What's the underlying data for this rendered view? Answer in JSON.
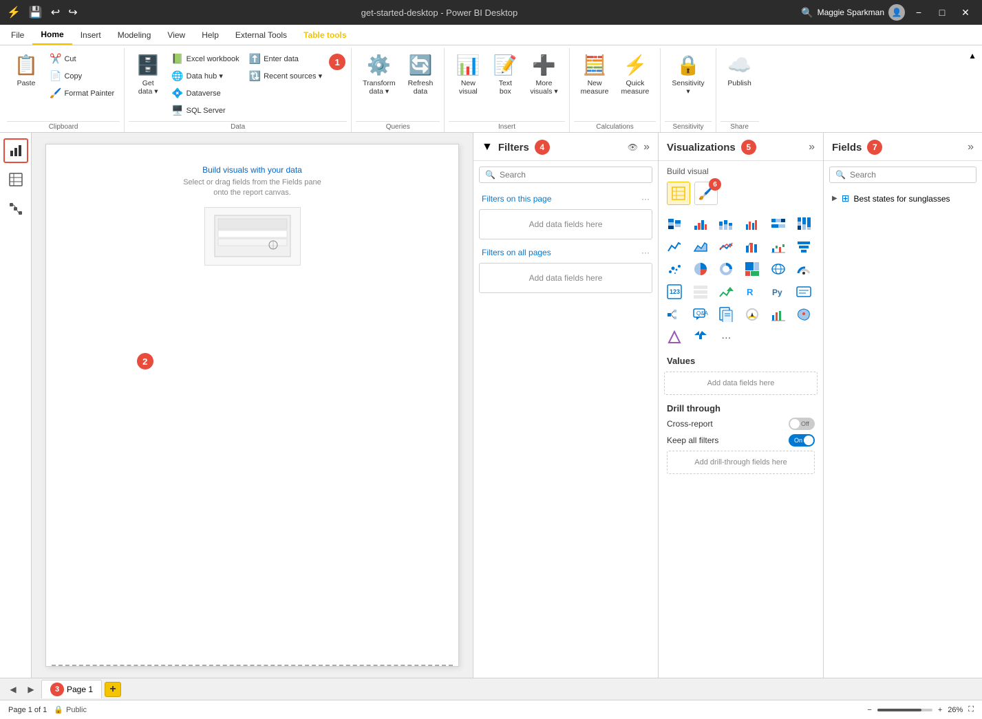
{
  "titleBar": {
    "title": "get-started-desktop - Power BI Desktop",
    "searchPlaceholder": "Search",
    "user": "Maggie Sparkman",
    "minimize": "−",
    "maximize": "□",
    "close": "✕",
    "saveIcon": "💾",
    "undoIcon": "↩",
    "redoIcon": "↪"
  },
  "menuBar": {
    "items": [
      {
        "label": "File",
        "active": false
      },
      {
        "label": "Home",
        "active": true
      },
      {
        "label": "Insert",
        "active": false
      },
      {
        "label": "Modeling",
        "active": false
      },
      {
        "label": "View",
        "active": false
      },
      {
        "label": "Help",
        "active": false
      },
      {
        "label": "External Tools",
        "active": false
      },
      {
        "label": "Table tools",
        "active": false,
        "highlighted": true
      }
    ]
  },
  "ribbon": {
    "groups": [
      {
        "label": "Clipboard",
        "items": [
          {
            "type": "large",
            "icon": "📋",
            "label": "Paste"
          },
          {
            "type": "small-col",
            "items": [
              {
                "icon": "✂️",
                "label": "Cut"
              },
              {
                "icon": "📄",
                "label": "Copy"
              },
              {
                "icon": "🖌️",
                "label": "Format Painter"
              }
            ]
          }
        ]
      },
      {
        "label": "Data",
        "items": [
          {
            "type": "large-split",
            "icon": "🗄️",
            "label": "Get\ndata",
            "hasDropdown": true
          },
          {
            "type": "small-col",
            "items": [
              {
                "icon": "📊",
                "label": "Excel workbook"
              },
              {
                "icon": "🌐",
                "label": "Data hub"
              },
              {
                "icon": "💠",
                "label": "Dataverse"
              },
              {
                "icon": "🖥️",
                "label": "SQL Server"
              }
            ]
          },
          {
            "type": "small-col",
            "items": [
              {
                "icon": "⬆️",
                "label": "Enter data"
              },
              {
                "icon": "🔃",
                "label": "Recent sources"
              }
            ]
          },
          {
            "type": "badge",
            "number": "1"
          }
        ]
      },
      {
        "label": "Queries",
        "items": [
          {
            "type": "large",
            "icon": "⚙️",
            "label": "Transform\ndata"
          },
          {
            "type": "large",
            "icon": "🔄",
            "label": "Refresh\ndata"
          }
        ]
      },
      {
        "label": "Insert",
        "items": [
          {
            "type": "large",
            "icon": "📊",
            "label": "New\nvisual"
          },
          {
            "type": "large",
            "icon": "📝",
            "label": "Text\nbox"
          },
          {
            "type": "large-split",
            "icon": "➕",
            "label": "More\nvisuals",
            "hasDropdown": true
          }
        ]
      },
      {
        "label": "Calculations",
        "items": [
          {
            "type": "large",
            "icon": "🧮",
            "label": "New\nmeasure"
          },
          {
            "type": "large",
            "icon": "⚡",
            "label": "Quick\nmeasure"
          }
        ]
      },
      {
        "label": "Sensitivity",
        "items": [
          {
            "type": "large-split",
            "icon": "🔒",
            "label": "Sensitivity",
            "hasDropdown": true
          }
        ]
      },
      {
        "label": "Share",
        "items": [
          {
            "type": "large",
            "icon": "☁️",
            "label": "Publish"
          }
        ]
      }
    ]
  },
  "leftSidebar": {
    "icons": [
      {
        "icon": "📊",
        "label": "Report",
        "active": true
      },
      {
        "icon": "⊞",
        "label": "Data",
        "active": false
      },
      {
        "icon": "🔗",
        "label": "Model",
        "active": false
      }
    ]
  },
  "canvas": {
    "hintTitle": "Build visuals with your data",
    "hintSub": "Select or drag fields from the Fields pane\nonto the report canvas.",
    "badge2": "2"
  },
  "filtersPane": {
    "title": "Filters",
    "badge": "4",
    "searchPlaceholder": "Search",
    "filtersOnPage": "Filters on this page",
    "addDataFields1": "Add data fields here",
    "filtersOnAllPages": "Filters on all pages",
    "addDataFields2": "Add data fields here"
  },
  "vizPane": {
    "title": "Visualizations",
    "badge": "5",
    "buildVisual": "Build visual",
    "badge6": "6",
    "vizIcons": [
      "⊞",
      "📊",
      "📈",
      "📊",
      "⊟",
      "📉",
      "📈",
      "⛰️",
      "〰️",
      "📊",
      "📉",
      "💹",
      "📊",
      "📊",
      "⋯",
      "🍩",
      "🔵",
      "⊠",
      "🌐",
      "🗺️",
      "🔷",
      "123",
      "≡",
      "▲",
      "⊞",
      "⊞",
      "⊞",
      "R",
      "Py",
      "📋",
      "⊞",
      "💬",
      "📄",
      "🏆",
      "📊",
      "🗺️",
      "◆",
      "»",
      "···"
    ],
    "valuesLabel": "Values",
    "addValuesFields": "Add data fields here",
    "drillLabel": "Drill through",
    "crossReport": "Cross-report",
    "keepAllFilters": "Keep all filters",
    "addDrillFields": "Add drill-through fields here"
  },
  "fieldsPane": {
    "title": "Fields",
    "badge": "7",
    "searchPlaceholder": "Search",
    "tables": [
      {
        "label": "Best states for sunglasses",
        "expanded": false
      }
    ]
  },
  "tabBar": {
    "pages": [
      {
        "label": "Page 1",
        "active": true,
        "badge": "3"
      }
    ],
    "addLabel": "+"
  },
  "statusBar": {
    "pageInfo": "Page 1 of 1",
    "visibility": "Public",
    "zoom": "26%"
  }
}
